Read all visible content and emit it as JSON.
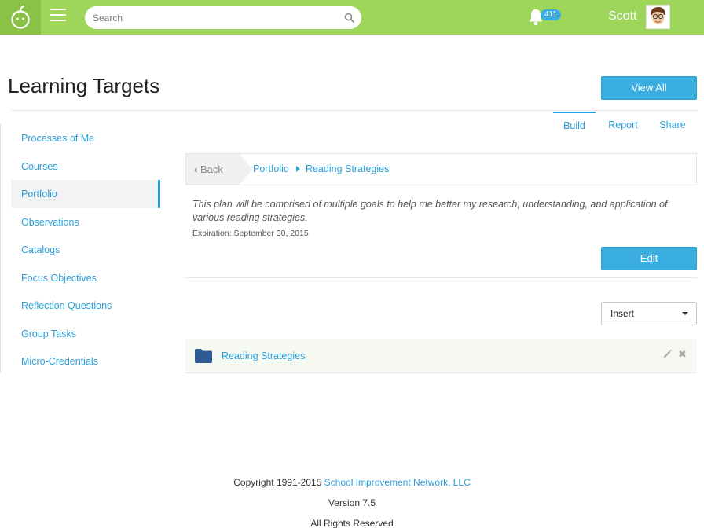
{
  "header": {
    "search_placeholder": "Search",
    "notification_count": "411",
    "user_name": "Scott"
  },
  "page": {
    "title": "Learning Targets",
    "view_all_label": "View All"
  },
  "sidebar": {
    "items": [
      {
        "label": "Processes of Me"
      },
      {
        "label": "Courses"
      },
      {
        "label": "Portfolio"
      },
      {
        "label": "Observations"
      },
      {
        "label": "Catalogs"
      },
      {
        "label": "Focus Objectives"
      },
      {
        "label": "Reflection Questions"
      },
      {
        "label": "Group Tasks"
      },
      {
        "label": "Micro-Credentials"
      }
    ],
    "active_index": 2
  },
  "tabs": [
    {
      "label": "Build"
    },
    {
      "label": "Report"
    },
    {
      "label": "Share"
    }
  ],
  "breadcrumb": {
    "back_label": "Back",
    "items": [
      {
        "label": "Portfolio"
      },
      {
        "label": "Reading Strategies"
      }
    ]
  },
  "plan": {
    "description": "This plan will be comprised of multiple goals to help me better my research, understanding, and application of various reading strategies.",
    "expiration": "Expiration: September 30, 2015",
    "edit_label": "Edit"
  },
  "insert": {
    "selected": "Insert"
  },
  "folder": {
    "label": "Reading Strategies"
  },
  "footer": {
    "copyright_prefix": "Copyright 1991-2015",
    "company": "School Improvement Network, LLC",
    "version": "Version 7.5",
    "rights": "All Rights Reserved"
  },
  "colors": {
    "header_green": "#9ed65b",
    "accent_blue": "#3aaee0",
    "link_blue": "#2b9fd8"
  }
}
